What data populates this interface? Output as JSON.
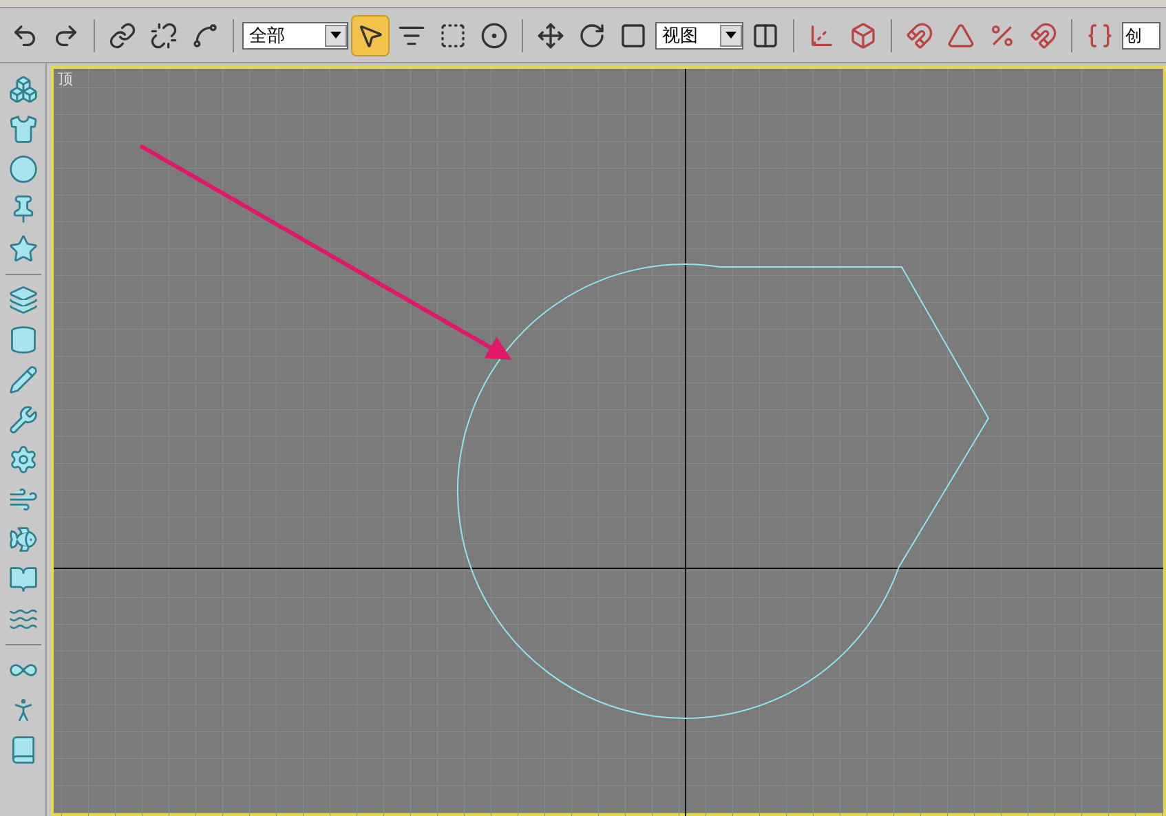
{
  "toolbar": {
    "tools": [
      {
        "selected": false
      },
      {
        "selected": false
      },
      {
        "selected": false
      },
      {
        "selected": false
      },
      {
        "selected": false
      },
      {
        "selected": true
      },
      {
        "selected": false
      },
      {
        "selected": false
      },
      {
        "selected": false
      },
      {
        "selected": false
      },
      {
        "selected": false
      },
      {
        "selected": false
      },
      {
        "selected": false
      }
    ],
    "selection_filter": {
      "value": "全部"
    },
    "reference_coordinate": {
      "value": "视图"
    },
    "named_selection": {
      "value": "创"
    }
  },
  "viewport": {
    "label": "顶",
    "active": true
  }
}
